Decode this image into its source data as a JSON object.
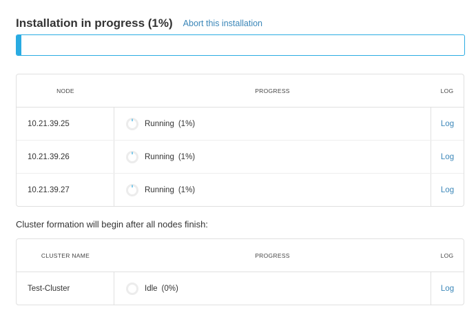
{
  "header": {
    "title": "Installation in progress (1%)",
    "abort_label": "Abort this installation"
  },
  "overall_progress": {
    "percent": 1,
    "color": "#29abe2"
  },
  "nodes_table": {
    "columns": {
      "node": "NODE",
      "progress": "PROGRESS",
      "log": "LOG"
    },
    "rows": [
      {
        "node": "10.21.39.25",
        "state": "Running",
        "percent_text": "(1%)",
        "log": "Log"
      },
      {
        "node": "10.21.39.26",
        "state": "Running",
        "percent_text": "(1%)",
        "log": "Log"
      },
      {
        "node": "10.21.39.27",
        "state": "Running",
        "percent_text": "(1%)",
        "log": "Log"
      }
    ]
  },
  "cluster_note": "Cluster formation will begin after all nodes finish:",
  "cluster_table": {
    "columns": {
      "name": "CLUSTER NAME",
      "progress": "PROGRESS",
      "log": "LOG"
    },
    "rows": [
      {
        "name": "Test-Cluster",
        "state": "Idle",
        "percent_text": "(0%)",
        "log": "Log"
      }
    ]
  },
  "colors": {
    "accent": "#29abe2",
    "link": "#3a86b8",
    "border": "#e0e0e0"
  }
}
